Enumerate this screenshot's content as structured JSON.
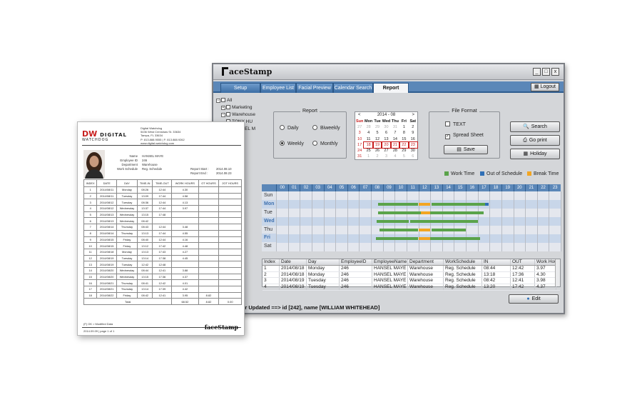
{
  "app": {
    "brand": "aceStamp",
    "window_buttons": [
      "_",
      "□",
      "x"
    ],
    "tabs": [
      {
        "label": "Setup",
        "active": false
      },
      {
        "label": "Employee List",
        "active": false
      },
      {
        "label": "Facial Preview",
        "active": false
      },
      {
        "label": "Calendar Search",
        "active": false
      },
      {
        "label": "Report",
        "active": true
      }
    ],
    "logout_label": "Logout",
    "tree": [
      {
        "label": "All",
        "indent": 0,
        "pm": "−"
      },
      {
        "label": "Marketing",
        "indent": 1,
        "pm": "+"
      },
      {
        "label": "Warehouse",
        "indent": 1,
        "pm": "−"
      },
      {
        "label": "TONY HU",
        "indent": 2,
        "pm": ""
      },
      {
        "label": "HANSEL M",
        "indent": 2,
        "pm": ""
      },
      {
        "label": "Suppor",
        "indent": 1,
        "pm": ""
      },
      {
        "label": "ption",
        "indent": 1,
        "pm": ""
      }
    ],
    "report_group": {
      "title": "Report",
      "options": [
        {
          "label": "Daily",
          "selected": false
        },
        {
          "label": "Biweekly",
          "selected": false
        },
        {
          "label": "Weekly",
          "selected": true
        },
        {
          "label": "Monthly",
          "selected": false
        }
      ]
    },
    "calendar": {
      "header": "2014 - 08",
      "prev": "<",
      "next": ">",
      "day_names": [
        "Sun",
        "Mon",
        "Tue",
        "Wed",
        "Thu",
        "Fri",
        "Sat"
      ],
      "weeks": [
        [
          "27",
          "28",
          "29",
          "30",
          "31",
          "1",
          "2"
        ],
        [
          "3",
          "4",
          "5",
          "6",
          "7",
          "8",
          "9"
        ],
        [
          "10",
          "11",
          "12",
          "13",
          "14",
          "15",
          "16"
        ],
        [
          "17",
          "18",
          "19",
          "20",
          "21",
          "22",
          "23"
        ],
        [
          "24",
          "25",
          "26",
          "27",
          "28",
          "29",
          "30"
        ],
        [
          "31",
          "1",
          "2",
          "3",
          "4",
          "5",
          "6"
        ]
      ]
    },
    "file_format": {
      "title": "File Format",
      "options": [
        {
          "label": "TEXT",
          "checked": false
        },
        {
          "label": "Spread Sheet",
          "checked": true
        }
      ],
      "save_label": "Save"
    },
    "actions": {
      "search": "Search",
      "goprint": "Go print",
      "holiday": "Holiday"
    },
    "chart_legend": [
      {
        "label": "Work Time",
        "color": "#5aa34a"
      },
      {
        "label": "Out of Schedule",
        "color": "#2f6fb6"
      },
      {
        "label": "Break Time",
        "color": "#f2a522"
      }
    ],
    "gantt": {
      "hours": [
        "00",
        "01",
        "02",
        "03",
        "04",
        "05",
        "06",
        "07",
        "08",
        "09",
        "10",
        "11",
        "12",
        "13",
        "14",
        "15",
        "16",
        "17",
        "18",
        "19",
        "20",
        "21",
        "22",
        "23"
      ],
      "days": [
        {
          "label": "Sun",
          "highlight": false
        },
        {
          "label": "Mon",
          "highlight": true
        },
        {
          "label": "Tue",
          "highlight": false
        },
        {
          "label": "Wed",
          "highlight": true
        },
        {
          "label": "Thu",
          "highlight": false
        },
        {
          "label": "Fri",
          "highlight": true
        },
        {
          "label": "Sat",
          "highlight": false
        }
      ],
      "bars": [
        {
          "day": 1,
          "start": 8.6,
          "end": 12.0,
          "type": "work"
        },
        {
          "day": 1,
          "start": 12.0,
          "end": 13.0,
          "type": "break"
        },
        {
          "day": 1,
          "start": 13.1,
          "end": 17.6,
          "type": "work"
        },
        {
          "day": 1,
          "start": 17.6,
          "end": 17.9,
          "type": "out"
        },
        {
          "day": 2,
          "start": 8.6,
          "end": 12.2,
          "type": "work"
        },
        {
          "day": 2,
          "start": 12.2,
          "end": 13.0,
          "type": "break"
        },
        {
          "day": 2,
          "start": 13.0,
          "end": 17.5,
          "type": "work"
        },
        {
          "day": 3,
          "start": 8.5,
          "end": 11.2,
          "type": "work"
        },
        {
          "day": 3,
          "start": 11.3,
          "end": 17.0,
          "type": "work"
        },
        {
          "day": 4,
          "start": 8.7,
          "end": 12.0,
          "type": "work"
        },
        {
          "day": 4,
          "start": 12.0,
          "end": 13.0,
          "type": "break"
        },
        {
          "day": 4,
          "start": 13.1,
          "end": 16.0,
          "type": "work"
        },
        {
          "day": 5,
          "start": 8.4,
          "end": 12.0,
          "type": "work"
        },
        {
          "day": 5,
          "start": 12.0,
          "end": 13.0,
          "type": "break"
        },
        {
          "day": 5,
          "start": 13.0,
          "end": 17.2,
          "type": "work"
        }
      ]
    },
    "table": {
      "columns": [
        "Index",
        "Date",
        "Day",
        "EmployeeID",
        "EmployeeName",
        "Department",
        "WorkSchedule",
        "IN",
        "OUT",
        "Work Hour"
      ],
      "rows": [
        [
          "1",
          "2014/08/18",
          "Monday",
          "246",
          "HANSEL MAYE",
          "Warehouse",
          "Reg. Schedule",
          "08:44",
          "12:42",
          "3.97"
        ],
        [
          "2",
          "2014/08/18",
          "Monday",
          "246",
          "HANSEL MAYE",
          "Warehouse",
          "Reg. Schedule",
          "13:18",
          "17:36",
          "4.30"
        ],
        [
          "3",
          "2014/08/19",
          "Tuesday",
          "246",
          "HANSEL MAYE",
          "Warehouse",
          "Reg. Schedule",
          "08:42",
          "12:41",
          "3.98"
        ],
        [
          "4",
          "2014/08/19",
          "Tuesday",
          "246",
          "HANSEL MAYE",
          "Warehouse",
          "Reg. Schedule",
          "13:20",
          "17:42",
          "4.37"
        ]
      ]
    },
    "edit_label": "Edit",
    "status_text": "ser Updated ==> id [242], name [WILLIAM WHITEHEAD]"
  },
  "paper": {
    "logo_main": "DW",
    "logo_rest": "DIGITAL",
    "logo_sub": "WATCHDOG",
    "address_lines": [
      "Digital Watchdog",
      "5436 West Crenshaw St. 33634",
      "Tampa, FL 33634",
      "P: 813.888.9555 | F: 813.888.9262",
      "www.digital-watchdog.com"
    ],
    "info_left": [
      {
        "label": "Name",
        "value": "HANSEL MAYE"
      },
      {
        "label": "Employee ID",
        "value": "246"
      },
      {
        "label": "Department",
        "value": "Warehouse"
      },
      {
        "label": "Work Schedule",
        "value": "Reg. Schedule"
      }
    ],
    "info_right": [
      {
        "label": "Report Start :",
        "value": "2014.08.10"
      },
      {
        "label": "Report End :",
        "value": "2014.08.23"
      }
    ],
    "columns": [
      "INDEX",
      "DATE",
      "DAY",
      "TIME-IN",
      "TIME-OUT",
      "WORK HOURS",
      "OT HOURS",
      "2OT HOURS"
    ],
    "rows": [
      [
        "1",
        "2014/08/11",
        "Monday",
        "08:26",
        "12:44",
        "4.30",
        "",
        ""
      ],
      [
        "2",
        "2014/08/11",
        "Tuesday",
        "13:09",
        "17:44",
        "4.58",
        "",
        ""
      ],
      [
        "3",
        "2014/08/12",
        "Tuesday",
        "08:36",
        "12:44",
        "4.13",
        "",
        ""
      ],
      [
        "4",
        "2014/08/12",
        "Wednesday",
        "13:37",
        "17:44",
        "3.97",
        "",
        ""
      ],
      [
        "5",
        "2014/08/13",
        "Wednesday",
        "13:15",
        "17:48",
        "",
        "",
        ""
      ],
      [
        "6",
        "2014/08/13",
        "Wednesday",
        "08:42",
        "",
        "",
        "",
        ""
      ],
      [
        "7",
        "2014/08/14",
        "Thursday",
        "08:43",
        "12:44",
        "3.48",
        "",
        ""
      ],
      [
        "8",
        "2014/08/14",
        "Thursday",
        "13:13",
        "17:44",
        "4.55",
        "",
        ""
      ],
      [
        "9",
        "2014/08/15",
        "Friday",
        "08:40",
        "12:44",
        "4.16",
        "",
        ""
      ],
      [
        "10",
        "2014/08/15",
        "Friday",
        "13:12",
        "17:42",
        "4.48",
        "",
        ""
      ],
      [
        "11",
        "2014/08/18",
        "Monday",
        "13:13",
        "17:43",
        "4.27",
        "",
        ""
      ],
      [
        "12",
        "2014/08/19",
        "Tuesday",
        "13:14",
        "17:38",
        "4.45",
        "",
        ""
      ],
      [
        "13",
        "2014/08/19",
        "Tuesday",
        "12:42",
        "12:48",
        "",
        "",
        ""
      ],
      [
        "14",
        "2014/08/20",
        "Wednesday",
        "08:44",
        "12:41",
        "3.88",
        "",
        ""
      ],
      [
        "15",
        "2014/08/20",
        "Wednesday",
        "13:15",
        "17:36",
        "4.37",
        "",
        ""
      ],
      [
        "16",
        "2014/08/21",
        "Thursday",
        "08:41",
        "12:42",
        "4.01",
        "",
        ""
      ],
      [
        "17",
        "2014/08/21",
        "Thursday",
        "13:14",
        "17:39",
        "4.42",
        "",
        ""
      ],
      [
        "18",
        "2014/08/22",
        "Friday",
        "08:42",
        "12:41",
        "3.95",
        "8.82",
        ""
      ]
    ],
    "total_label": "Total",
    "total_values": [
      "68.52",
      "8.82",
      "0.00"
    ],
    "footer_note": "(F) OK > Modified Data",
    "footer_date": "2014.09.09 | page 1 of 1",
    "footer_logo": "aceStamp"
  }
}
